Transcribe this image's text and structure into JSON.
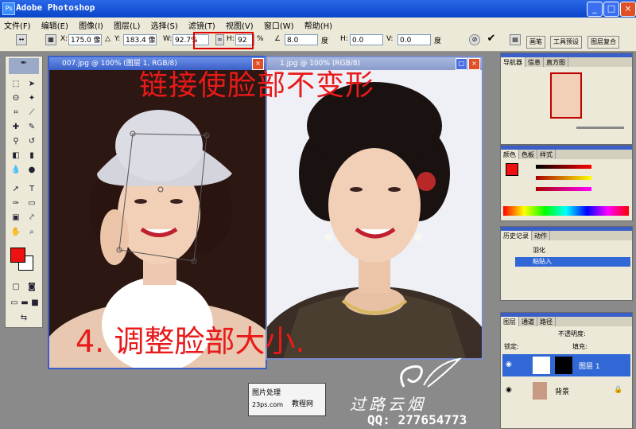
{
  "window": {
    "title": "Adobe Photoshop"
  },
  "menu": [
    "文件(F)",
    "编辑(E)",
    "图像(I)",
    "图层(L)",
    "选择(S)",
    "滤镜(T)",
    "视图(V)",
    "窗口(W)",
    "帮助(H)"
  ],
  "options": {
    "x_label": "X:",
    "x_value": "175.0 像",
    "y_label": "Y:",
    "y_value": "183.4 像",
    "w_label": "W:",
    "w_value": "92.7%",
    "h_label": "H:",
    "h_value": "92",
    "h_unit": "%",
    "angle_value": "8.0",
    "hskew_label": "H:",
    "hskew_value": "0.0",
    "vskew_label": "V:",
    "vskew_value": "0.0",
    "deg1": "度",
    "deg2": "度"
  },
  "well": [
    "画笔",
    "工具预设",
    "图层复合"
  ],
  "doc1": {
    "title": "007.jpg @ 100% (图层 1, RGB/8)"
  },
  "doc2": {
    "title": "1.jpg @ 100% (RGB/8)"
  },
  "annotations": {
    "top": "链接使脸部不变形",
    "bottom": "4. 调整脸部大小."
  },
  "palettes": {
    "navigator": {
      "tabs": [
        "导航器",
        "信息",
        "直方图"
      ]
    },
    "color": {
      "tabs": [
        "颜色",
        "色板",
        "样式"
      ]
    },
    "history": {
      "tabs": [
        "历史记录",
        "动作"
      ],
      "items": [
        "羽化",
        "粘贴入"
      ]
    },
    "layers": {
      "tabs": [
        "图层",
        "通道",
        "路径"
      ],
      "opacity_label": "不透明度:",
      "lock_label": "锁定:",
      "fill_label": "填充:",
      "layer1": "图层 1",
      "background": "背景"
    }
  },
  "watermark": {
    "box_line1": "图片处理",
    "box_line2": "23ps.com",
    "box_line3": "教程网",
    "signature": "过路云烟",
    "qq": "QQ: 277654773"
  },
  "colors": {
    "foreground": "#ee1111",
    "background": "#ffffff",
    "accent": "#e81a1a"
  }
}
